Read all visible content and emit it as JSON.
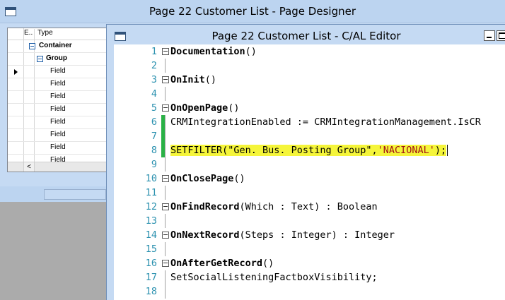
{
  "page_designer": {
    "title": "Page 22 Customer List - Page Designer",
    "grid": {
      "headers": {
        "e": "E..",
        "type": "Type"
      },
      "rows": [
        {
          "type": "Container",
          "bold": true,
          "expander": true
        },
        {
          "type": "Group",
          "bold": true,
          "expander": true
        },
        {
          "type": "Field",
          "bold": false,
          "current": true
        },
        {
          "type": "Field"
        },
        {
          "type": "Field"
        },
        {
          "type": "Field"
        },
        {
          "type": "Field"
        },
        {
          "type": "Field"
        },
        {
          "type": "Field"
        },
        {
          "type": "Field"
        }
      ],
      "scroll_left": "<"
    }
  },
  "editor": {
    "title": "Page 22 Customer List - C/AL Editor",
    "lines": [
      {
        "n": "1",
        "trigger": "Documentation",
        "rest": "()"
      },
      {
        "n": "2",
        "text": ""
      },
      {
        "n": "3",
        "trigger": "OnInit",
        "rest": "()"
      },
      {
        "n": "4",
        "text": ""
      },
      {
        "n": "5",
        "trigger": "OnOpenPage",
        "rest": "()"
      },
      {
        "n": "6",
        "text": "CRMIntegrationEnabled := CRMIntegrationManagement.IsCR"
      },
      {
        "n": "7",
        "text": ""
      },
      {
        "n": "8",
        "pre": "SETFILTER(\"Gen. Bus. Posting Group\",",
        "str": "'NACIONAL'",
        "post": ");"
      },
      {
        "n": "9",
        "text": ""
      },
      {
        "n": "10",
        "trigger": "OnClosePage",
        "rest": "()"
      },
      {
        "n": "11",
        "text": ""
      },
      {
        "n": "12",
        "trigger": "OnFindRecord",
        "rest": "(Which : Text) : Boolean"
      },
      {
        "n": "13",
        "text": ""
      },
      {
        "n": "14",
        "trigger": "OnNextRecord",
        "rest": "(Steps : Integer) : Integer"
      },
      {
        "n": "15",
        "text": ""
      },
      {
        "n": "16",
        "trigger": "OnAfterGetRecord",
        "rest": "()"
      },
      {
        "n": "17",
        "text": "SetSocialListeningFactboxVisibility;"
      },
      {
        "n": "18",
        "text": ""
      }
    ]
  },
  "colors": {
    "line_number": "#2b91af",
    "string": "#a31515",
    "highlight": "#f5f53a",
    "change_bar": "#2ab146",
    "window_chrome": "#c5daf3"
  }
}
